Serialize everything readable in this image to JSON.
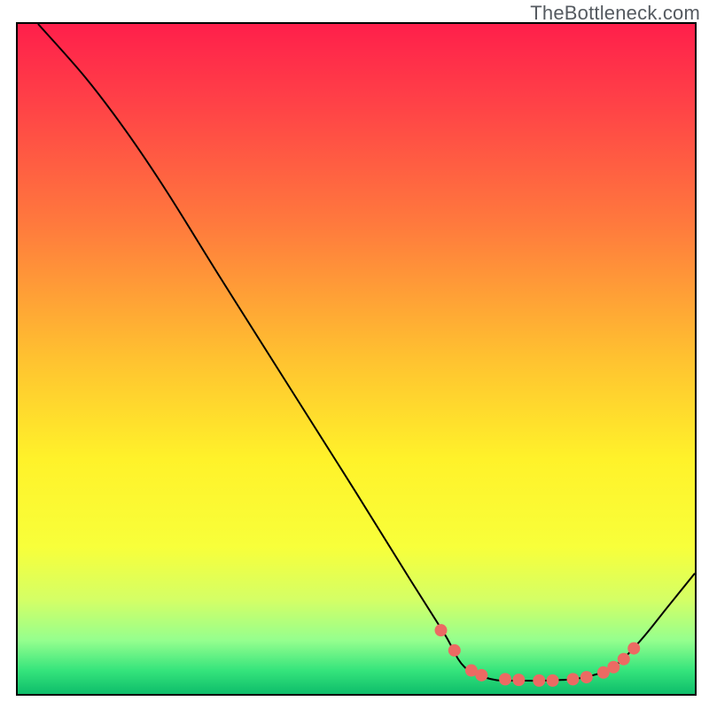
{
  "watermark": "TheBottleneck.com",
  "chart_data": {
    "type": "line",
    "title": "",
    "xlabel": "",
    "ylabel": "",
    "xlim": [
      0,
      100
    ],
    "ylim": [
      0,
      100
    ],
    "background_gradient_stops": [
      {
        "offset": 0,
        "color": "#ff1f4b"
      },
      {
        "offset": 0.12,
        "color": "#ff4247"
      },
      {
        "offset": 0.3,
        "color": "#ff7a3d"
      },
      {
        "offset": 0.5,
        "color": "#ffc230"
      },
      {
        "offset": 0.65,
        "color": "#fff22a"
      },
      {
        "offset": 0.78,
        "color": "#f8ff3a"
      },
      {
        "offset": 0.86,
        "color": "#d4ff66"
      },
      {
        "offset": 0.92,
        "color": "#95ff8e"
      },
      {
        "offset": 0.965,
        "color": "#35e47c"
      },
      {
        "offset": 1.0,
        "color": "#0ebd6a"
      }
    ],
    "series": [
      {
        "name": "curve",
        "color": "#000000",
        "stroke_width": 2,
        "points": [
          {
            "x": 3,
            "y": 100
          },
          {
            "x": 10,
            "y": 92
          },
          {
            "x": 16,
            "y": 84
          },
          {
            "x": 22,
            "y": 75
          },
          {
            "x": 30,
            "y": 62
          },
          {
            "x": 40,
            "y": 46
          },
          {
            "x": 50,
            "y": 30
          },
          {
            "x": 58,
            "y": 17
          },
          {
            "x": 63,
            "y": 9
          },
          {
            "x": 66,
            "y": 4
          },
          {
            "x": 70,
            "y": 2.2
          },
          {
            "x": 74,
            "y": 2.0
          },
          {
            "x": 78,
            "y": 2.0
          },
          {
            "x": 82,
            "y": 2.2
          },
          {
            "x": 85,
            "y": 2.8
          },
          {
            "x": 88,
            "y": 4
          },
          {
            "x": 92,
            "y": 8
          },
          {
            "x": 96,
            "y": 13
          },
          {
            "x": 100,
            "y": 18
          }
        ]
      }
    ],
    "markers": {
      "color": "#ec6a63",
      "radius": 7,
      "points": [
        {
          "x": 62.5,
          "y": 9.5
        },
        {
          "x": 64.5,
          "y": 6.5
        },
        {
          "x": 67,
          "y": 3.5
        },
        {
          "x": 68.5,
          "y": 2.8
        },
        {
          "x": 72,
          "y": 2.2
        },
        {
          "x": 74,
          "y": 2.1
        },
        {
          "x": 77,
          "y": 2.0
        },
        {
          "x": 79,
          "y": 2.0
        },
        {
          "x": 82,
          "y": 2.2
        },
        {
          "x": 84,
          "y": 2.5
        },
        {
          "x": 86.5,
          "y": 3.2
        },
        {
          "x": 88,
          "y": 4.0
        },
        {
          "x": 89.5,
          "y": 5.2
        },
        {
          "x": 91,
          "y": 6.8
        }
      ]
    }
  }
}
